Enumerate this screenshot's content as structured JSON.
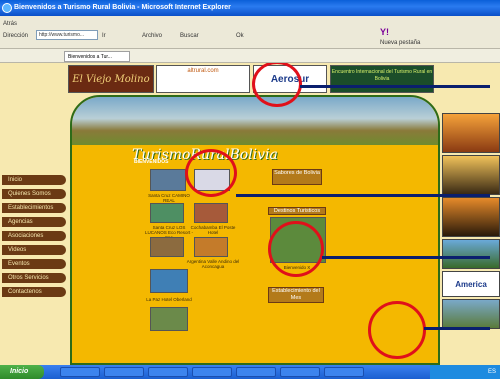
{
  "window": {
    "title": "Bienvenidos a Turismo Rural Bolivia - Microsoft Internet Explorer"
  },
  "toolbar": {
    "back": "Atrás",
    "address_label": "Dirección",
    "address": "http://www.turismo...",
    "go": "Ir",
    "archivo": "Archivo",
    "search": "Buscar",
    "ok": "Ok",
    "yahoo": "Y!",
    "pestana": "Nueva pestaña"
  },
  "tab": {
    "label": "Bienvenidos a Tur..."
  },
  "banners": {
    "viejo_molino": "El Viejo Molino",
    "altrural": "altrural.com",
    "aerosur": "Aerosur",
    "encuentro": "Encuentro Internacional del Turismo Rural en Bolivia"
  },
  "site": {
    "logo": "TurismoRuralBolivia",
    "welcome": "BIENVENIDOS"
  },
  "menu": [
    "Inicio",
    "Quienes Somos",
    "Establecimientos",
    "Agencias",
    "Asociaciones",
    "Videos",
    "Eventos",
    "Otros Servicios",
    "Contactenos"
  ],
  "thumbs": [
    {
      "caption": "Santa Cruz CAMINO REAL"
    },
    {
      "caption": "Santa Cruz LOS LUCANOS Eco Resort - Spa"
    },
    {
      "caption": "Cochabamba El Poste Hotel"
    },
    {
      "caption": "Argentina Valle Andino del Aconcagua"
    },
    {
      "caption": "La Paz Hotel Oberland"
    }
  ],
  "boxes": {
    "sabores": "Sabores de Bolivia",
    "destinos": "Destinos Turisticos",
    "mapa_caption": "Bienvenido X",
    "establecimiento": "Establecimiento del Mes"
  },
  "sidebar": {
    "america": "America"
  },
  "taskbar": {
    "start": "Inicio",
    "clock": "ES"
  },
  "colors": {
    "marker": "#e0101a",
    "pointer": "#0a1f6e",
    "eco_yellow": "#f4b800"
  }
}
